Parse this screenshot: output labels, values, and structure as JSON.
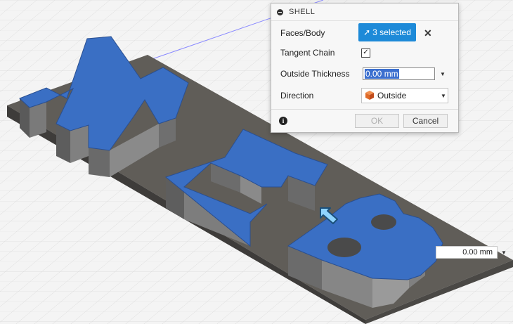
{
  "colors": {
    "accent": "#1d8ad8",
    "face_highlight": "#3a6fc4",
    "body_grey": "#6e6e6e",
    "plate_top": "#605d58"
  },
  "panel": {
    "title": "SHELL",
    "collapse_icon": "minus-circle-icon",
    "faces_body": {
      "label": "Faces/Body",
      "selection_text": "3 selected",
      "cursor_icon": "cursor-arrow-icon",
      "clear_icon": "close-icon"
    },
    "tangent_chain": {
      "label": "Tangent Chain",
      "checked": true
    },
    "outside_thickness": {
      "label": "Outside Thickness",
      "value": "0.00 mm"
    },
    "direction": {
      "label": "Direction",
      "value": "Outside",
      "icon": "outside-direction-icon"
    },
    "footer": {
      "info_icon": "info-icon",
      "ok_label": "OK",
      "cancel_label": "Cancel"
    }
  },
  "floating_input": {
    "value": "0.00 mm"
  }
}
